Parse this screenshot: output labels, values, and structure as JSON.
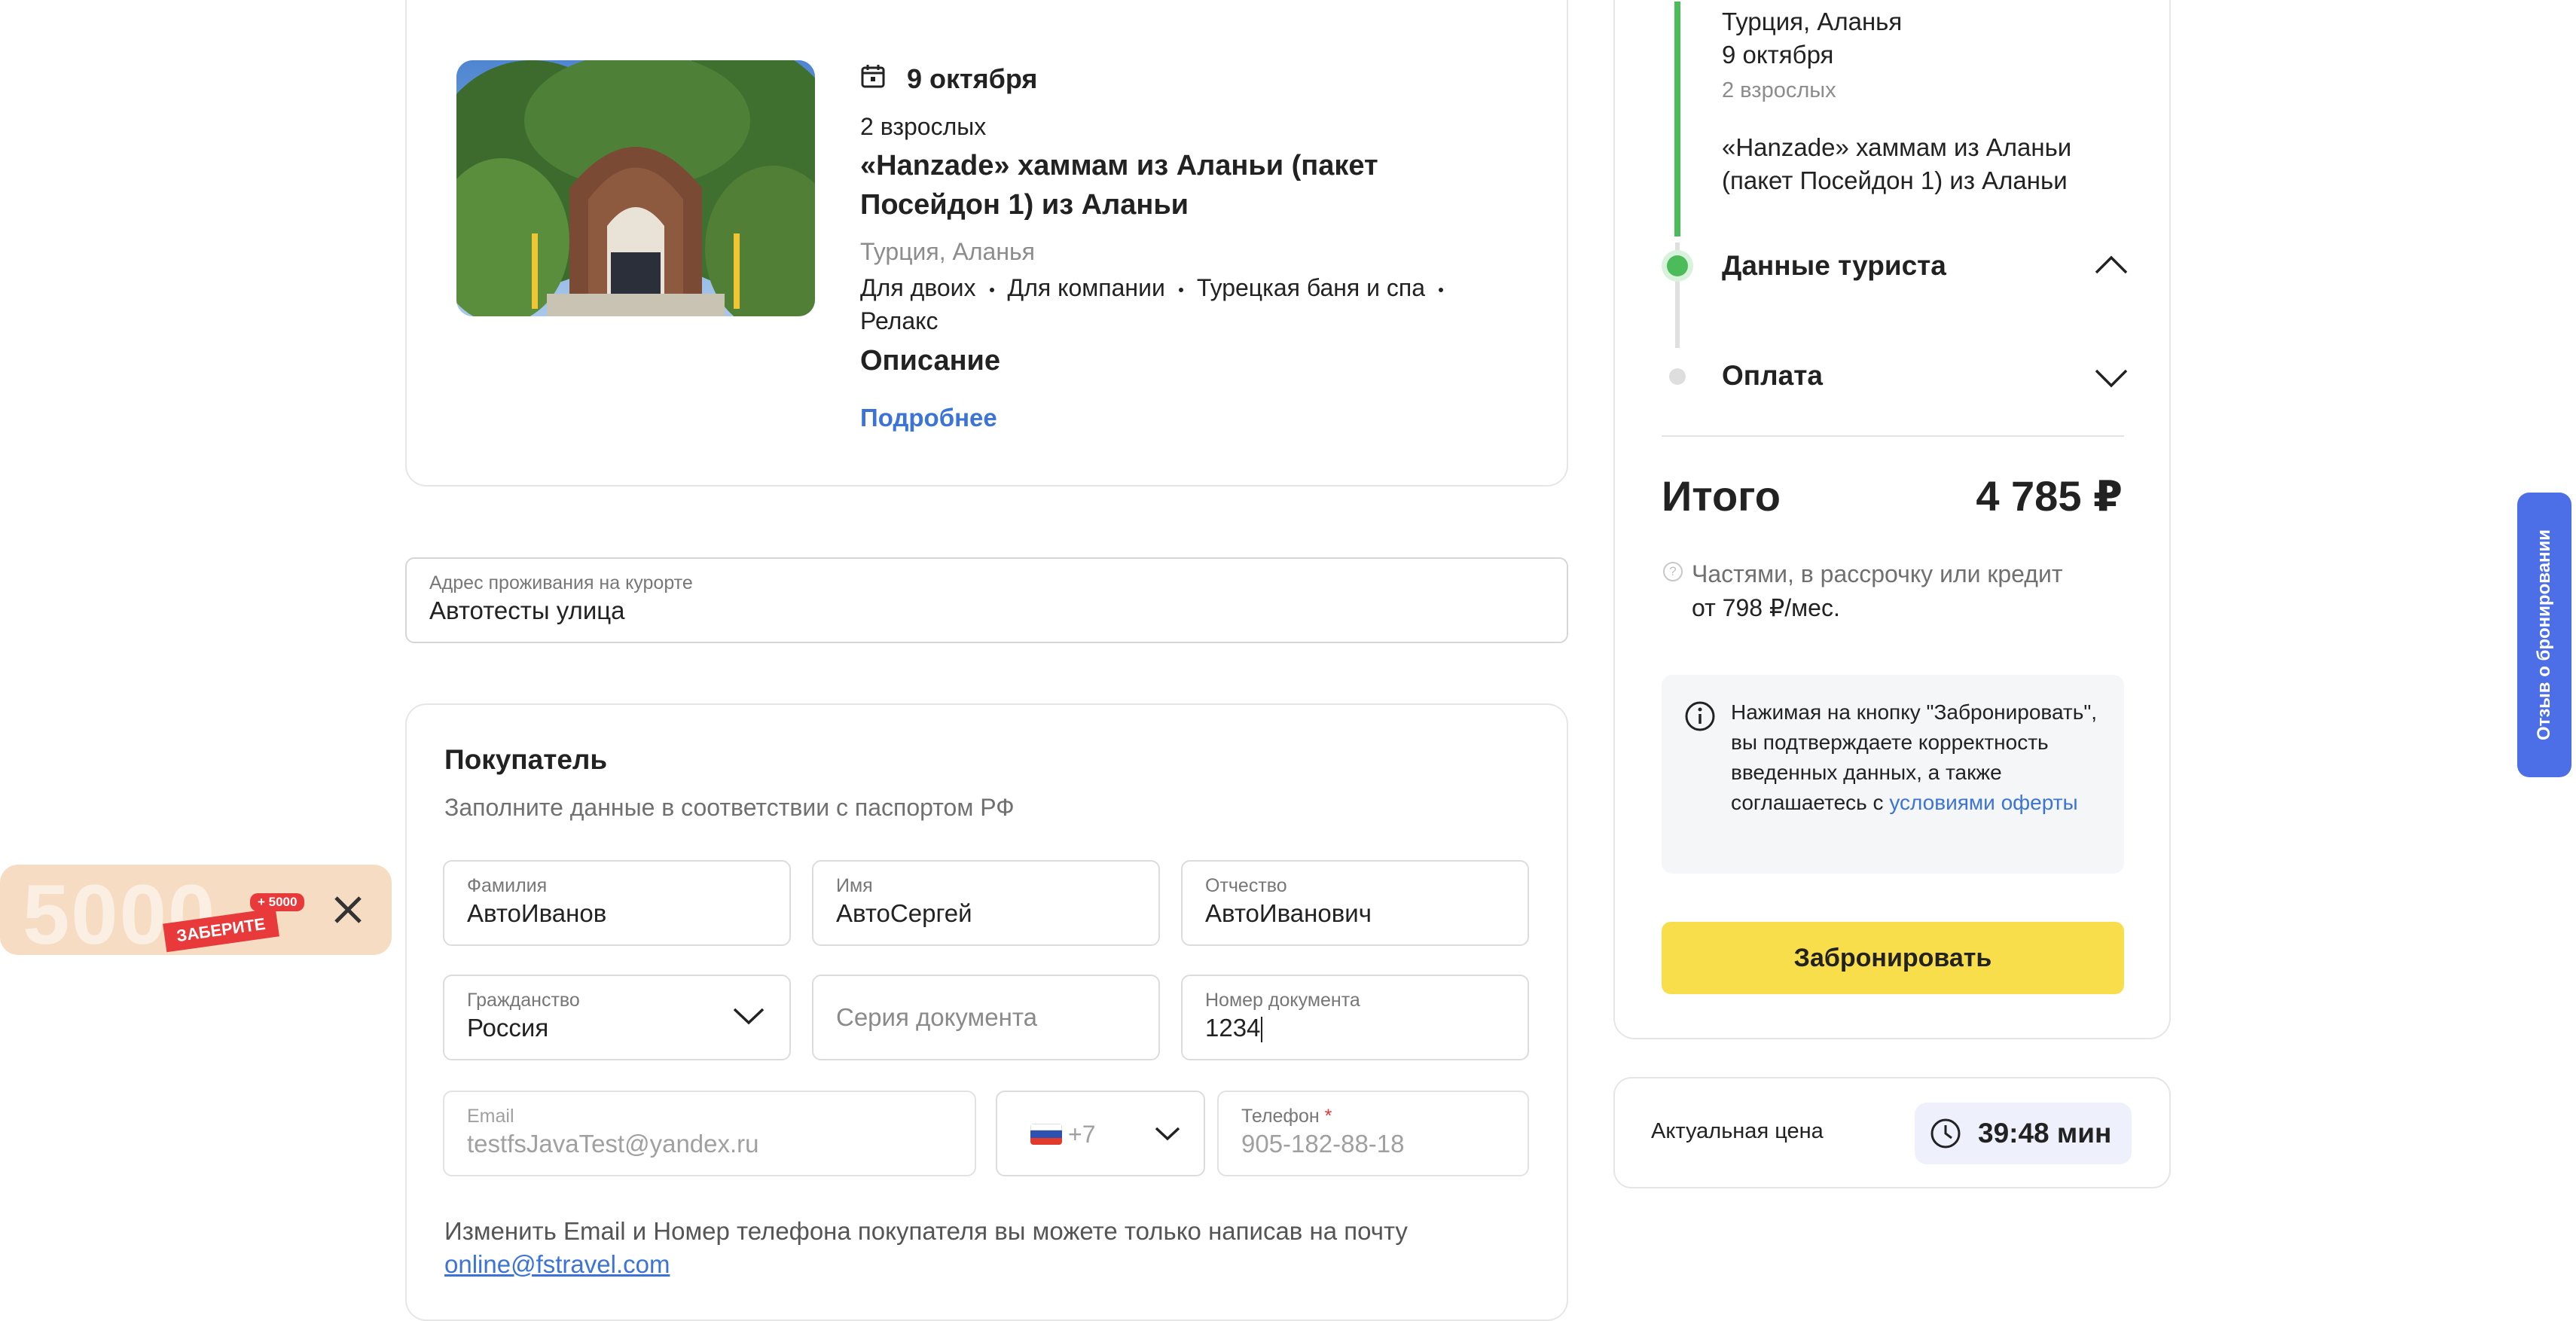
{
  "tour": {
    "date": "9 октября",
    "guests": "2 взрослых",
    "title": "«Hanzade» хаммам из Аланьи (пакет Посейдон 1) из Аланьи",
    "location": "Турция, Аланья",
    "tags": [
      "Для двоих",
      "Для компании",
      "Турецкая баня и спа",
      "Релакс"
    ],
    "description_heading": "Описание",
    "more_link": "Подробнее"
  },
  "address": {
    "label": "Адрес проживания на курорте",
    "value": "Автотесты улица"
  },
  "buyer": {
    "heading": "Покупатель",
    "hint": "Заполните данные в соответствии с паспортом РФ",
    "last_name": {
      "label": "Фамилия",
      "value": "АвтоИванов"
    },
    "first_name": {
      "label": "Имя",
      "value": "АвтоСергей"
    },
    "middle_name": {
      "label": "Отчество",
      "value": "АвтоИванович"
    },
    "citizenship": {
      "label": "Гражданство",
      "value": "Россия"
    },
    "doc_series": {
      "placeholder": "Серия документа"
    },
    "doc_number": {
      "label": "Номер документа",
      "value": "1234"
    },
    "email": {
      "label": "Email",
      "value": "testfsJavaTest@yandex.ru"
    },
    "phone_code": "+7",
    "phone": {
      "label": "Телефон",
      "required_mark": "*",
      "value": "905-182-88-18"
    },
    "change_note": "Изменить Email и Номер телефона покупателя вы можете только написав на почту",
    "support_email": "online@fstravel.com"
  },
  "promo": {
    "amount": "5000",
    "badge": "+ 5000",
    "ribbon": "ЗАБЕРИТЕ"
  },
  "summary": {
    "location": "Турция, Аланья",
    "date": "9 октября",
    "guests": "2 взрослых",
    "tour_title": "«Hanzade» хаммам из Аланьи (пакет Посейдон 1) из Аланьи",
    "steps": [
      {
        "label": "Данные туриста",
        "state": "active"
      },
      {
        "label": "Оплата",
        "state": "pending"
      }
    ],
    "total_label": "Итого",
    "total_value": "4 785 ₽",
    "installment_line1": "Частями, в рассрочку или кредит",
    "installment_line2": "от 798 ₽/мес.",
    "notice_text": "Нажимая на кнопку \"Забронировать\", вы подтверждаете корректность введенных данных, а также соглашаетесь с",
    "notice_link": "условиями оферты",
    "book_button": "Забронировать"
  },
  "timer": {
    "label": "Актуальная цена",
    "value": "39:48 мин"
  },
  "feedback_tab": "Отзыв о бронировании",
  "colors": {
    "accent_yellow": "#f9de4b",
    "link_blue": "#3b73d9",
    "step_green": "#4cbb5a",
    "feedback_blue": "#4c6ee6",
    "timer_bg": "#eef1fb"
  }
}
